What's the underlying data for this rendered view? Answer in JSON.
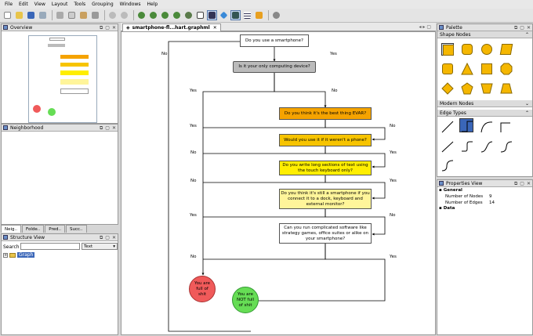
{
  "menu": [
    "File",
    "Edit",
    "View",
    "Layout",
    "Tools",
    "Grouping",
    "Windows",
    "Help"
  ],
  "panels": {
    "overview": "Overview",
    "neighborhood": "Neighborhood",
    "structure": "Structure View",
    "palette": "Palette",
    "properties": "Properties View"
  },
  "tabs": [
    "Neig..",
    "Folde..",
    "Pred..",
    "Succ.."
  ],
  "search": {
    "label": "Search",
    "value": "",
    "mode": "Text"
  },
  "tree": {
    "root": "Graph"
  },
  "document": {
    "tab": "smartphone-fl...hart.graphml"
  },
  "palette": {
    "shape_nodes": "Shape Nodes",
    "modern_nodes": "Modern Nodes",
    "edge_types": "Edge Types"
  },
  "properties": {
    "general": "General",
    "rows": [
      {
        "k": "Number of Nodes",
        "v": "9"
      },
      {
        "k": "Number of Edges",
        "v": "14"
      }
    ],
    "data": "Data"
  },
  "flow": {
    "q1": "Do you use a smartphone?",
    "q2": "Is it your only computing device?",
    "q3": "Do you think it's the best thing EVAR?",
    "q4": "Would you use it if it weren't a phone?",
    "q5": "Do you write long sections of text using the touch keyboard only?",
    "q6": "Do you think it's still a smartphone if you connect it to a dock, keyboard and external monitor?",
    "q7": "Can you run complicated software like strategy games, office suites or alike on your smartphone?",
    "r1": "You are full of shit",
    "r2": "You are NOT full of shit",
    "yes": "Yes",
    "no": "No"
  },
  "colors": {
    "orange": "#f5a300",
    "lightorange": "#f7c400",
    "yellow": "#ffee00",
    "paleyellow": "#fff59a",
    "red": "#f05a5a",
    "green": "#66dd55",
    "gray": "#bbbbbb"
  }
}
